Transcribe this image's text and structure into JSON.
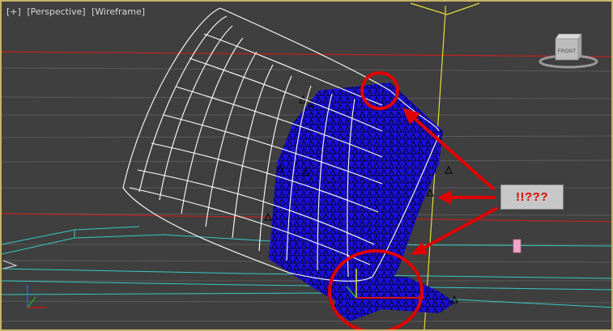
{
  "viewport": {
    "labels": {
      "plus": "[+]",
      "view": "[Perspective]",
      "shading": "[Wireframe]"
    },
    "viewcube": {
      "face_label": "FRONT"
    }
  },
  "annotation": {
    "text": "!!???"
  },
  "colors": {
    "viewport_border": "#c7b36a",
    "background": "#3f3f3f",
    "mesh_solid": "#1a0fd8",
    "wireframe": "#ffffff",
    "annotation_red": "#e10000",
    "guide_yellow": "#e6dc3a",
    "grid_red": "#c02020",
    "cyan_lines": "#35c9c3"
  }
}
